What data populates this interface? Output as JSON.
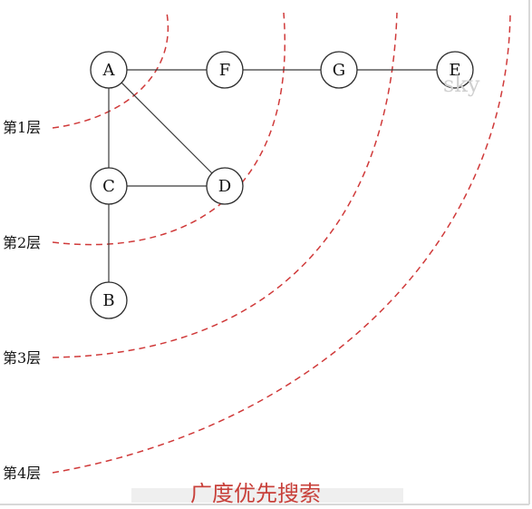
{
  "diagram": {
    "title": "广度优先搜索",
    "watermark": "sky",
    "nodes": [
      {
        "id": "A",
        "label": "A"
      },
      {
        "id": "F",
        "label": "F"
      },
      {
        "id": "G",
        "label": "G"
      },
      {
        "id": "E",
        "label": "E"
      },
      {
        "id": "C",
        "label": "C"
      },
      {
        "id": "D",
        "label": "D"
      },
      {
        "id": "B",
        "label": "B"
      }
    ],
    "edges": [
      {
        "from": "A",
        "to": "F"
      },
      {
        "from": "F",
        "to": "G"
      },
      {
        "from": "G",
        "to": "E"
      },
      {
        "from": "A",
        "to": "C"
      },
      {
        "from": "A",
        "to": "D"
      },
      {
        "from": "C",
        "to": "D"
      },
      {
        "from": "C",
        "to": "B"
      }
    ],
    "layers": [
      {
        "label": "第1层"
      },
      {
        "label": "第2层"
      },
      {
        "label": "第3层"
      },
      {
        "label": "第4层"
      }
    ],
    "colors": {
      "arc": "#d03a3a",
      "caption": "#c8403a"
    }
  }
}
